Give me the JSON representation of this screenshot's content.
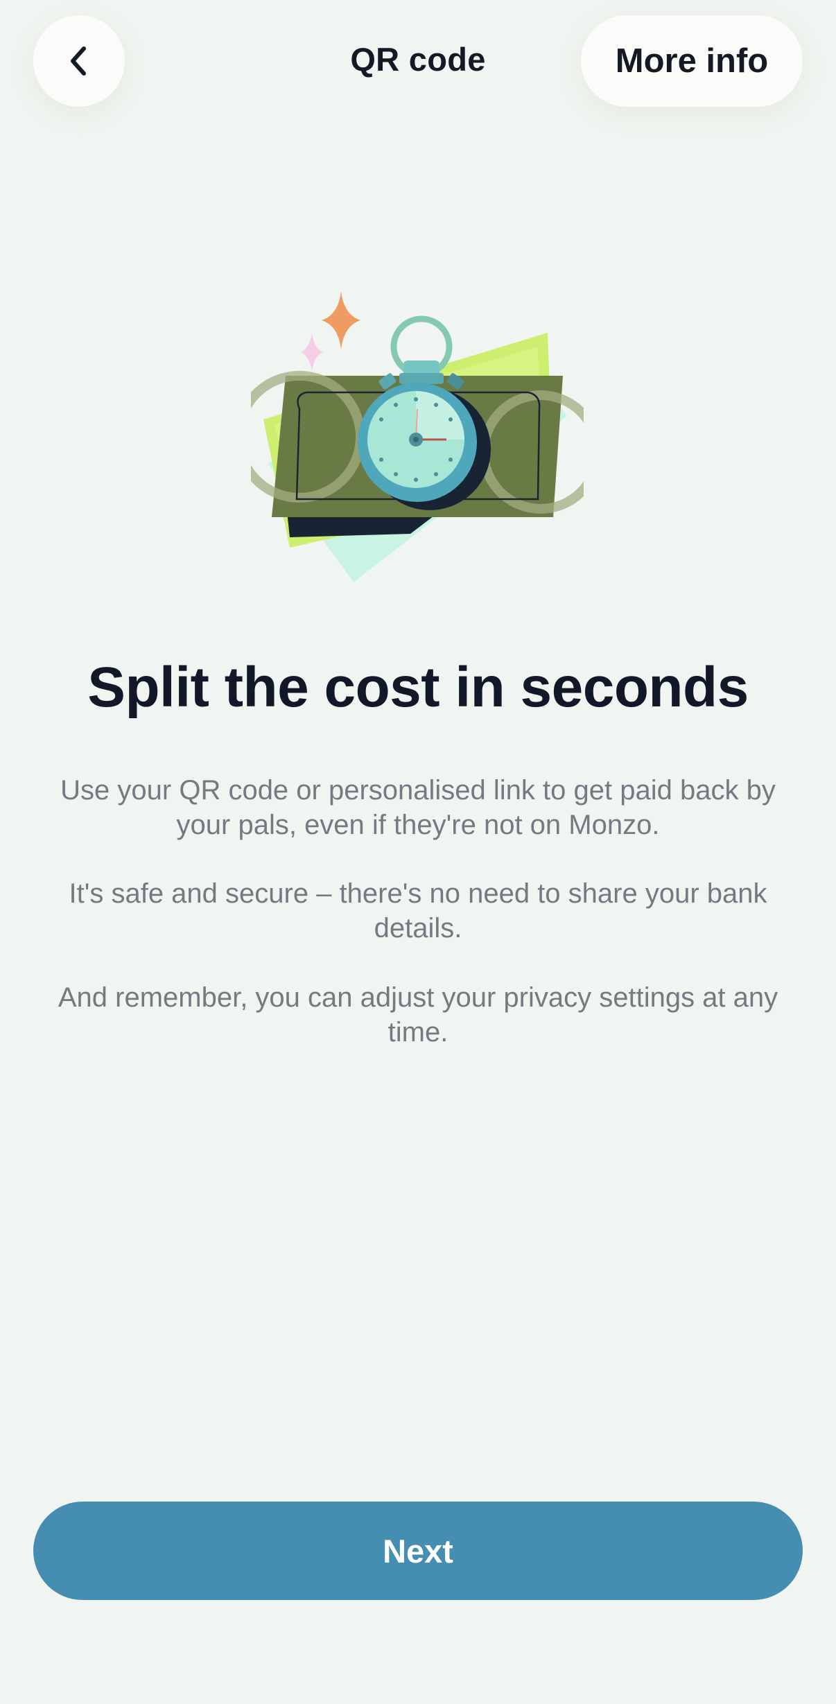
{
  "header": {
    "title": "QR code",
    "more_info_label": "More info",
    "back_icon": "chevron-left-icon"
  },
  "illustration": {
    "icon": "stopwatch-on-banknotes-illustration"
  },
  "main": {
    "headline": "Split the cost in seconds",
    "paragraphs": [
      "Use your QR code or personalised link to get paid back by your pals, even if they're not on Monzo.",
      "It's safe and secure – there's no need to share your bank details.",
      "And remember, you can adjust your privacy settings at any time."
    ]
  },
  "footer": {
    "next_label": "Next"
  },
  "colors": {
    "background": "#f1f5f1",
    "primary_button": "#468db2",
    "text_heading": "#111827",
    "text_body": "#737a82"
  }
}
